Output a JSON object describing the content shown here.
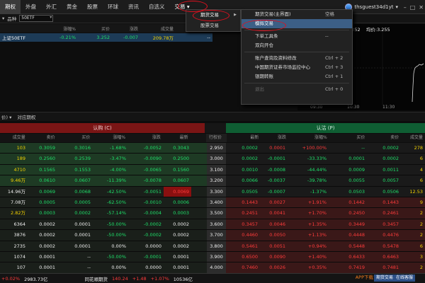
{
  "nav": {
    "items": [
      "期权",
      "外盘",
      "外汇",
      "黄金",
      "股票",
      "环球",
      "资讯",
      "自选义",
      "交易"
    ],
    "user": "thsguest34d1yt",
    "user_caret": "▾"
  },
  "symbar": {
    "label_left": "▾",
    "label_pinzhong": "品种",
    "symbol": "50ETF"
  },
  "quote_header": [
    "",
    "涨幅%",
    "买价",
    "涨跌",
    "成交量",
    ""
  ],
  "quote_row": {
    "name": "上证50ETF",
    "chg_pct": "-0.21%",
    "price": "3.252",
    "change": "-0.007",
    "volume": "209.78万",
    "extra": "--"
  },
  "chart": {
    "price_label": "3.252",
    "high_label": "均价:3.255",
    "times": [
      "09:30",
      "10:30",
      "11:30"
    ],
    "line_color": "#d9d9d9"
  },
  "menu1": {
    "items": [
      {
        "label": "期货交易",
        "arrow": "▶"
      },
      {
        "label": "股票交易",
        "arrow": ""
      }
    ]
  },
  "menu2": {
    "items": [
      {
        "label": "期货交易(主界面)",
        "shortcut": "空格"
      },
      {
        "label": "模拟交易",
        "shortcut": ""
      },
      {
        "label": "下单工具条",
        "shortcut": "--"
      },
      {
        "label": "双向开仓",
        "shortcut": ""
      },
      {
        "label": "账户查询及资料修改",
        "shortcut": "Ctrl + 2"
      },
      {
        "label": "中国期货证券市场监控中心",
        "shortcut": "Ctrl + 3"
      },
      {
        "label": "银期转账",
        "shortcut": "Ctrl + 1"
      },
      {
        "label": "退出",
        "shortcut": "Ctrl + 0"
      }
    ]
  },
  "optbar": {
    "dropdown": "价) ▾",
    "label": "对应期权"
  },
  "section": {
    "call": "认购 (C)",
    "put": "认沽 (P)"
  },
  "columns": {
    "call": [
      "成交量",
      "卖价",
      "买价",
      "涨幅%",
      "涨跌",
      "最新"
    ],
    "strike": "行权价",
    "put": [
      "最新",
      "涨跌",
      "涨幅%",
      "买价",
      "卖价",
      "成交量"
    ]
  },
  "rows": [
    {
      "call": [
        "103",
        "0.3059",
        "0.3016",
        "-1.68%",
        "-0.0052",
        "0.3043"
      ],
      "strike": "2.950",
      "put": [
        "0.0002",
        "0.0001",
        "+100.00%",
        "--",
        "0.0002",
        "278"
      ]
    },
    {
      "call": [
        "189",
        "0.2560",
        "0.2539",
        "-3.47%",
        "-0.0090",
        "0.2500"
      ],
      "strike": "3.000",
      "put": [
        "0.0002",
        "-0.0001",
        "-33.33%",
        "0.0001",
        "0.0002",
        "6"
      ]
    },
    {
      "call": [
        "4710",
        "0.1565",
        "0.1553",
        "-4.00%",
        "-0.0065",
        "0.1560"
      ],
      "strike": "3.100",
      "put": [
        "0.0010",
        "-0.0008",
        "-44.44%",
        "0.0009",
        "0.0011",
        "4"
      ]
    },
    {
      "call": [
        "9.46万",
        "0.0610",
        "0.0607",
        "-11.39%",
        "-0.0078",
        "0.0607"
      ],
      "strike": "3.200",
      "put": [
        "0.0066",
        "-0.0037",
        "-39.78%",
        "0.0055",
        "0.0057",
        "6"
      ]
    },
    {
      "call": [
        "14.96万",
        "0.0069",
        "0.0068",
        "-42.50%",
        "-0.0051",
        "0.0069"
      ],
      "strike": "3.300",
      "put": [
        "0.0505",
        "-0.0007",
        "-1.37%",
        "0.0503",
        "0.0506",
        "12.53"
      ]
    },
    {
      "call": [
        "7.08万",
        "0.0005",
        "0.0005",
        "-62.50%",
        "-0.0010",
        "0.0006"
      ],
      "strike": "3.400",
      "put": [
        "0.1443",
        "0.0027",
        "+1.91%",
        "0.1442",
        "0.1443",
        "9"
      ]
    },
    {
      "call": [
        "2.82万",
        "0.0003",
        "0.0002",
        "-57.14%",
        "-0.0004",
        "0.0003"
      ],
      "strike": "3.500",
      "put": [
        "0.2451",
        "0.0041",
        "+1.70%",
        "0.2450",
        "0.2461",
        "2"
      ]
    },
    {
      "call": [
        "6364",
        "0.0002",
        "0.0001",
        "-50.00%",
        "-0.0002",
        "0.0002"
      ],
      "strike": "3.600",
      "put": [
        "0.3457",
        "0.0046",
        "+1.35%",
        "0.3449",
        "0.3457",
        "2"
      ]
    },
    {
      "call": [
        "3876",
        "0.0002",
        "0.0001",
        "-50.00%",
        "-0.0002",
        "0.0002"
      ],
      "strike": "3.700",
      "put": [
        "0.4460",
        "0.0050",
        "+1.13%",
        "0.4448",
        "0.4476",
        "2"
      ]
    },
    {
      "call": [
        "2735",
        "0.0002",
        "0.0001",
        "0.00%",
        "0.0000",
        "0.0002"
      ],
      "strike": "3.800",
      "put": [
        "0.5461",
        "0.0051",
        "+0.94%",
        "0.5448",
        "0.5478",
        "6"
      ]
    },
    {
      "call": [
        "1074",
        "0.0001",
        "--",
        "-50.00%",
        "-0.0001",
        "0.0001"
      ],
      "strike": "3.900",
      "put": [
        "0.6500",
        "0.0090",
        "+1.40%",
        "0.6433",
        "0.6463",
        "3"
      ]
    },
    {
      "call": [
        "107",
        "0.0001",
        "--",
        "0.00%",
        "0.0000",
        "0.0001"
      ],
      "strike": "4.000",
      "put": [
        "0.7460",
        "0.0026",
        "+0.35%",
        "0.7419",
        "0.7481",
        "2"
      ]
    }
  ],
  "status": {
    "a": "+0.02%",
    "b": "2983.73亿",
    "c": "同花顺期货",
    "d": "140.24",
    "e": "+1.48",
    "f": "+1.07%",
    "g": "10536亿",
    "app": "APP下载",
    "btn1": "期货交易",
    "btn2": "在线客服"
  }
}
